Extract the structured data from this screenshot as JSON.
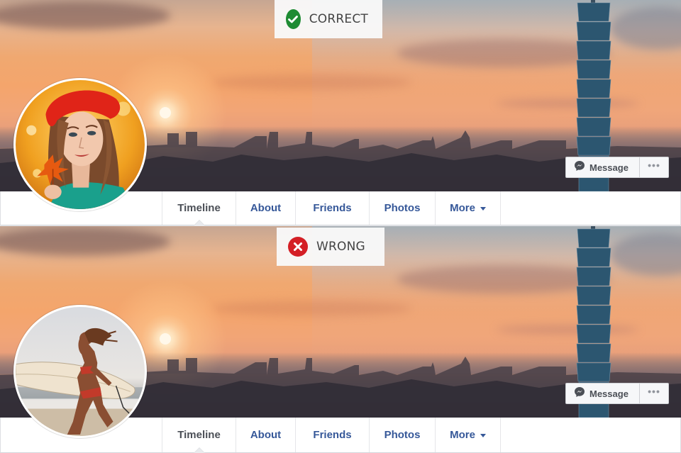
{
  "examples": [
    {
      "verdict": "correct",
      "badge": {
        "label": "CORRECT",
        "icon": "check-circle-icon",
        "color": "#1e8b33"
      },
      "avatar": {
        "subject": "woman in red beret holding autumn maple leaf, close-up portrait"
      },
      "cover": {
        "subject": "city skyline at sunset with Taipei 101 tower"
      },
      "actions": {
        "message_label": "Message",
        "more_label": "•••"
      },
      "tabs": [
        {
          "label": "Timeline",
          "active": true
        },
        {
          "label": "About",
          "active": false
        },
        {
          "label": "Friends",
          "active": false
        },
        {
          "label": "Photos",
          "active": false
        },
        {
          "label": "More",
          "active": false,
          "dropdown": true
        }
      ]
    },
    {
      "verdict": "wrong",
      "badge": {
        "label": "WRONG",
        "icon": "x-circle-icon",
        "color": "#d41f25"
      },
      "avatar": {
        "subject": "woman running on beach carrying surfboard, distant full-body shot"
      },
      "cover": {
        "subject": "city skyline at sunset with Taipei 101 tower"
      },
      "actions": {
        "message_label": "Message",
        "more_label": "•••"
      },
      "tabs": [
        {
          "label": "Timeline",
          "active": true
        },
        {
          "label": "About",
          "active": false
        },
        {
          "label": "Friends",
          "active": false
        },
        {
          "label": "Photos",
          "active": false
        },
        {
          "label": "More",
          "active": false,
          "dropdown": true
        }
      ]
    }
  ],
  "colors": {
    "tab_link": "#365899",
    "tab_active": "#4b4f56",
    "button_text": "#4b4f56"
  }
}
